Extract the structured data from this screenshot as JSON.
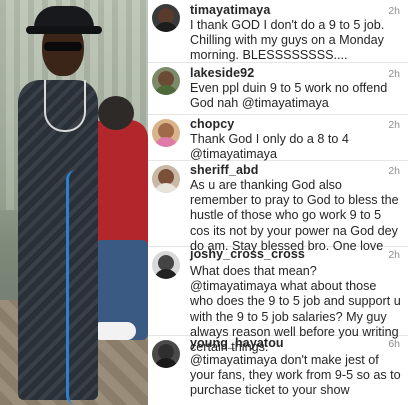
{
  "comments": [
    {
      "username": "timayatimaya",
      "time": "2h",
      "text": "I thank GOD I don't do a 9 to 5 job. Chilling with my guys on a Monday morning. BLESSSSSSSS...."
    },
    {
      "username": "lakeside92",
      "time": "2h",
      "text": "Even ppl duin 9 to 5 work no offend God nah  @timayatimaya"
    },
    {
      "username": "chopcy",
      "time": "2h",
      "text": "Thank God I only do a 8 to 4 @timayatimaya"
    },
    {
      "username": "sheriff_abd",
      "time": "2h",
      "text": "As u are thanking God also remember to pray to God to bless the hustle of those who go work 9 to 5 cos its not by your power na God dey do am.  Stay blessed bro. One love"
    },
    {
      "username": "joshy_cross_cross",
      "time": "2h",
      "text": "What does that mean?@timayatimaya what about those who does the 9 to 5 job and support u with the 9 to 5 job salaries? My guy always reason well before you  writing certain things."
    },
    {
      "username": "young_hayatou",
      "time": "6h",
      "text": "@timayatimaya don't make jest of your fans, they work from 9-5 so as to purchase ticket to your show"
    }
  ]
}
